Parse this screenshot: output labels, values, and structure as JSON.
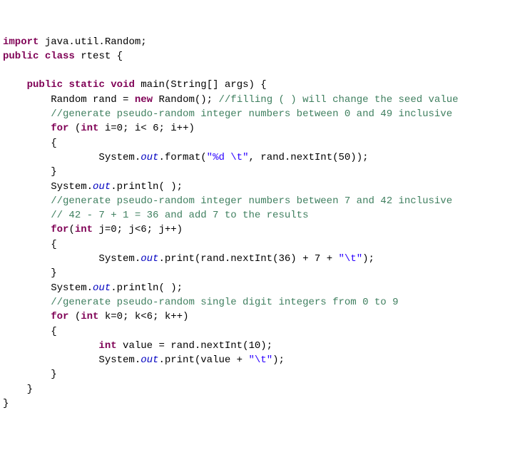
{
  "code": {
    "import_kw": "import",
    "import_pkg": " java.util.Random;",
    "public_kw": "public",
    "class_kw": "class",
    "class_name": " rtest {",
    "static_kw": "static",
    "void_kw": "void",
    "main_sig": " main(String[] args) {",
    "rand_decl_lhs": "        Random rand = ",
    "new_kw": "new",
    "rand_decl_rhs": " Random(); ",
    "cmt_seed": "//filling ( ) will change the seed value",
    "cmt_gen049": "        //generate pseudo-random integer numbers between 0 and 49 inclusive",
    "for_kw": "for",
    "for_i_head": " (",
    "int_kw": "int",
    "for_i_cond": " i=0; i< 6; i++)",
    "lbrace": "        {",
    "sys_out_pre": "                System.",
    "out_fld": "out",
    "format_call": ".format(",
    "fmt_str": "\"%d \\t\"",
    "format_args": ", rand.nextInt(50));",
    "rbrace": "        }",
    "println1_pre": "        System.",
    "println1_post": ".println( );",
    "cmt_gen742": "        //generate pseudo-random integer numbers between 7 and 42 inclusive",
    "cmt_calc": "        // 42 - 7 + 1 = 36 and add 7 to the results",
    "for_j_head": "(",
    "for_j_cond": " j=0; j<6; j++)",
    "print_j_pre": "                System.",
    "print_j_mid": ".print(rand.nextInt(36) + 7 + ",
    "tab_str": "\"\\t\"",
    "print_j_end": ");",
    "println2_pre": "        System.",
    "println2_post": ".println( );",
    "cmt_gen09": "        //generate pseudo-random single digit integers from 0 to 9",
    "for_k_head": " (",
    "for_k_cond": " k=0; k<6; k++)",
    "val_decl_pre": "                ",
    "val_decl_post": " value = rand.nextInt(10);",
    "print_k_pre": "                System.",
    "print_k_mid": ".print(value + ",
    "print_k_end": ");",
    "rbrace_main": "    }",
    "rbrace_cls": "}"
  }
}
